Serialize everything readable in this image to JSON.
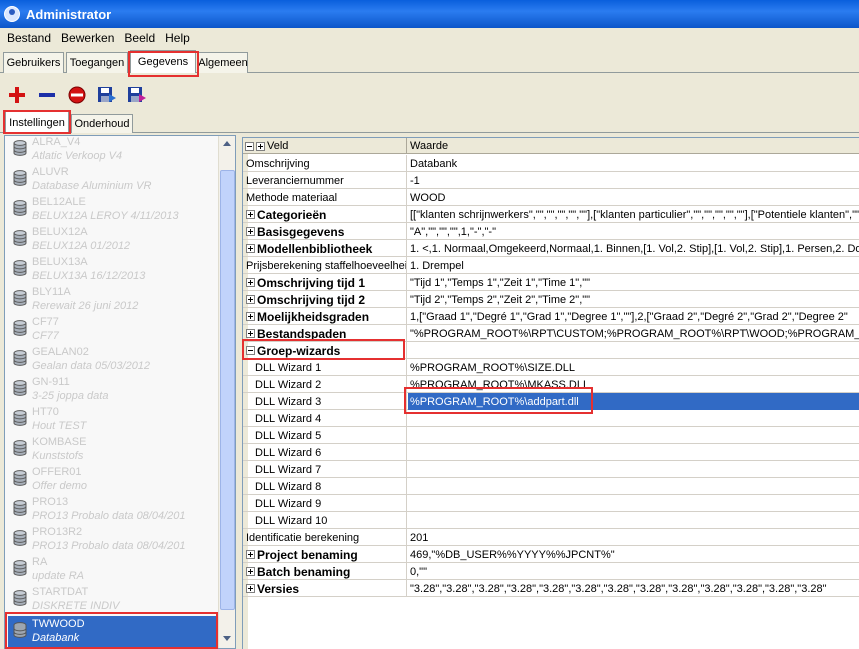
{
  "window": {
    "title": "Administrator"
  },
  "menu": [
    "Bestand",
    "Bewerken",
    "Beeld",
    "Help"
  ],
  "main_tabs": [
    "Gebruikers",
    "Toegangen",
    "Gegevens",
    "Algemeen"
  ],
  "active_main_tab": "Gegevens",
  "toolbar": {
    "buttons": [
      "add-icon",
      "remove-icon",
      "delete-icon",
      "save-icon",
      "save-as-icon"
    ]
  },
  "sub_tabs": [
    "Instellingen",
    "Onderhoud"
  ],
  "active_sub_tab": "Instellingen",
  "left_list": {
    "items": [
      {
        "name": "ALRA_V4",
        "desc": "Atlatic Verkoop V4"
      },
      {
        "name": "ALUVR",
        "desc": "Database Aluminium VR"
      },
      {
        "name": "BEL12ALE",
        "desc": "BELUX12A LEROY 4/11/2013"
      },
      {
        "name": "BELUX12A",
        "desc": "BELUX12A 01/2012"
      },
      {
        "name": "BELUX13A",
        "desc": "BELUX13A 16/12/2013"
      },
      {
        "name": "BLY11A",
        "desc": "Rerewait 26 juni 2012"
      },
      {
        "name": "CF77",
        "desc": "CF77"
      },
      {
        "name": "GEALAN02",
        "desc": "Gealan data 05/03/2012"
      },
      {
        "name": "GN-911",
        "desc": "3-25 joppa data"
      },
      {
        "name": "HT70",
        "desc": "Hout TEST"
      },
      {
        "name": "KOMBASE",
        "desc": "Kunststofs"
      },
      {
        "name": "OFFER01",
        "desc": "Offer demo"
      },
      {
        "name": "PRO13",
        "desc": "PRO13 Probalo data 08/04/201"
      },
      {
        "name": "PRO13R2",
        "desc": "PRO13 Probalo data 08/04/201"
      },
      {
        "name": "RA",
        "desc": "update RA"
      },
      {
        "name": "STARTDAT",
        "desc": "DISKRETE INDIV"
      }
    ],
    "selected": {
      "name": "TWWOOD",
      "desc": "Databank"
    }
  },
  "grid": {
    "headers": [
      "Veld",
      "Waarde"
    ],
    "rows": [
      {
        "type": "plain",
        "key": "Omschrijving",
        "value": "Databank"
      },
      {
        "type": "plain",
        "key": "Leveranciernummer",
        "value": "-1"
      },
      {
        "type": "plain",
        "key": "Methode materiaal",
        "value": "WOOD"
      },
      {
        "type": "group-collapsed",
        "key": "Categorieën",
        "value": "[[\"klanten schrijnwerkers\",\"\",\"\",\"\",\"\",\"\"],[\"klanten  particulier\",\"\",\"\",\"\",\"\",\"\"],[\"Potentiele klanten\",\"\",\""
      },
      {
        "type": "group-collapsed",
        "key": "Basisgegevens",
        "value": "\"A\",\"\",\"\",\"\",1,\"-\",\"-\""
      },
      {
        "type": "group-collapsed",
        "key": "Modellenbibliotheek",
        "value": "1. <,1. Normaal,Omgekeerd,Normaal,1. Binnen,[1. Vol,2. Stip],[1. Vol,2. Stip],1. Persen,2. Doorlo"
      },
      {
        "type": "plain",
        "key": "Prijsberekening staffelhoeveelheid",
        "value": "1. Drempel"
      },
      {
        "type": "group-collapsed",
        "key": "Omschrijving tijd 1",
        "value": "\"Tijd 1\",\"Temps 1\",\"Zeit 1\",\"Time 1\",\"\""
      },
      {
        "type": "group-collapsed",
        "key": "Omschrijving tijd 2",
        "value": "\"Tijd 2\",\"Temps 2\",\"Zeit 2\",\"Time 2\",\"\""
      },
      {
        "type": "group-collapsed",
        "key": "Moelijkheidsgraden",
        "value": "1,[\"Graad 1\",\"Degré 1\",\"Grad 1\",\"Degree 1\",\"\"],2,[\"Graad 2\",\"Degré 2\",\"Grad 2\",\"Degree 2\""
      },
      {
        "type": "group-collapsed",
        "key": "Bestandspaden",
        "value": "\"%PROGRAM_ROOT%\\RPT\\CUSTOM;%PROGRAM_ROOT%\\RPT\\WOOD;%PROGRAM_R"
      },
      {
        "type": "group-expanded",
        "key": "Groep-wizards",
        "value": ""
      },
      {
        "type": "sub",
        "key": "DLL Wizard 1",
        "value": "%PROGRAM_ROOT%\\SIZE.DLL"
      },
      {
        "type": "sub",
        "key": "DLL Wizard 2",
        "value": "%PROGRAM_ROOT%\\MKASS.DLL"
      },
      {
        "type": "sub-selected",
        "key": "DLL Wizard 3",
        "value": "%PROGRAM_ROOT%\\addpart.dll"
      },
      {
        "type": "sub",
        "key": "DLL Wizard 4",
        "value": ""
      },
      {
        "type": "sub",
        "key": "DLL Wizard 5",
        "value": ""
      },
      {
        "type": "sub",
        "key": "DLL Wizard 6",
        "value": ""
      },
      {
        "type": "sub",
        "key": "DLL Wizard 7",
        "value": ""
      },
      {
        "type": "sub",
        "key": "DLL Wizard 8",
        "value": ""
      },
      {
        "type": "sub",
        "key": "DLL Wizard 9",
        "value": ""
      },
      {
        "type": "sub",
        "key": "DLL Wizard 10",
        "value": ""
      },
      {
        "type": "plain",
        "key": "Identificatie berekening",
        "value": "201"
      },
      {
        "type": "group-collapsed",
        "key": "Project benaming",
        "value": "469,\"%DB_USER%%YYYY%%JPCNT%\""
      },
      {
        "type": "group-collapsed",
        "key": "Batch benaming",
        "value": "0,\"\""
      },
      {
        "type": "group-collapsed",
        "key": "Versies",
        "value": "\"3.28\",\"3.28\",\"3.28\",\"3.28\",\"3.28\",\"3.28\",\"3.28\",\"3.28\",\"3.28\",\"3.28\",\"3.28\",\"3.28\",\"3.28\""
      }
    ]
  },
  "colors": {
    "selection": "#316ac5",
    "highlight_box": "#e53030",
    "titlebar": "#0a5fdc"
  }
}
